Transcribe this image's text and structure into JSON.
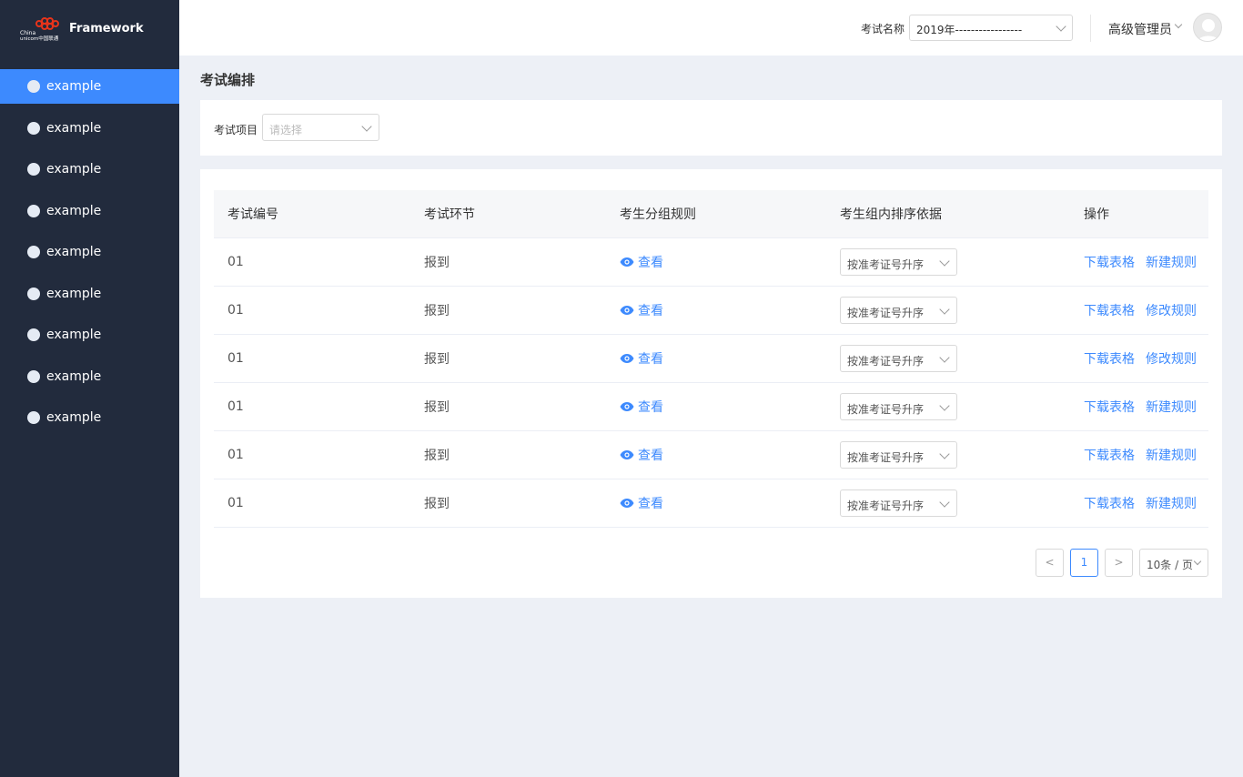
{
  "app": {
    "brand_text": "Framework",
    "logo_text": "China unicom中国联通"
  },
  "sidebar": {
    "items": [
      {
        "label": "example"
      },
      {
        "label": "example"
      },
      {
        "label": "example"
      },
      {
        "label": "example"
      },
      {
        "label": "example"
      },
      {
        "label": "example"
      },
      {
        "label": "example"
      },
      {
        "label": "example"
      },
      {
        "label": "example"
      }
    ]
  },
  "header": {
    "exam_label": "考试名称",
    "exam_value": "2019年-----------------",
    "user_name": "高级管理员"
  },
  "page": {
    "title": "考试编排"
  },
  "filter": {
    "label": "考试项目",
    "placeholder": "请选择"
  },
  "table": {
    "headers": [
      "考试编号",
      "考试环节",
      "考生分组规则",
      "考生组内排序依据",
      "操作"
    ],
    "rows": [
      {
        "id": "01",
        "stage": "报到",
        "view": "查看",
        "sort": "按准考证号升序",
        "download": "下载表格",
        "rule": "新建规则"
      },
      {
        "id": "01",
        "stage": "报到",
        "view": "查看",
        "sort": "按准考证号升序",
        "download": "下载表格",
        "rule": "修改规则"
      },
      {
        "id": "01",
        "stage": "报到",
        "view": "查看",
        "sort": "按准考证号升序",
        "download": "下载表格",
        "rule": "修改规则"
      },
      {
        "id": "01",
        "stage": "报到",
        "view": "查看",
        "sort": "按准考证号升序",
        "download": "下载表格",
        "rule": "新建规则"
      },
      {
        "id": "01",
        "stage": "报到",
        "view": "查看",
        "sort": "按准考证号升序",
        "download": "下载表格",
        "rule": "新建规则"
      },
      {
        "id": "01",
        "stage": "报到",
        "view": "查看",
        "sort": "按准考证号升序",
        "download": "下载表格",
        "rule": "新建规则"
      }
    ]
  },
  "pagination": {
    "prev": "<",
    "current_page": "1",
    "next": ">",
    "page_size": "10条 / 页"
  },
  "colors": {
    "accent": "#3d8afe",
    "sidebar_bg": "#222b3d",
    "page_bg": "#edf0f6"
  }
}
